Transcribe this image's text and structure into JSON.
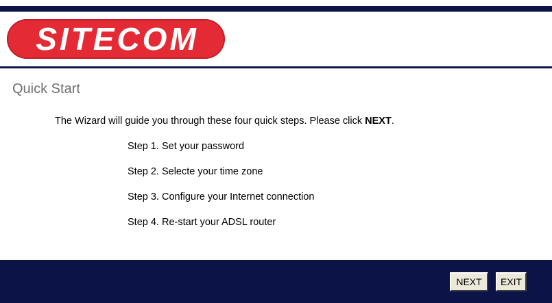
{
  "brand": {
    "logo_text": "SITECOM",
    "logo_color": "#e42a35",
    "bar_color": "#0c1447"
  },
  "page": {
    "title": "Quick Start",
    "intro_prefix": "The Wizard will guide you through these four quick steps. Please click ",
    "intro_emphasis": "NEXT",
    "intro_suffix": "."
  },
  "steps": [
    "Step 1. Set your password",
    "Step 2. Selecte your time zone",
    "Step 3. Configure your Internet connection",
    "Step 4. Re-start your ADSL router"
  ],
  "footer": {
    "next_label": "NEXT",
    "exit_label": "EXIT"
  }
}
